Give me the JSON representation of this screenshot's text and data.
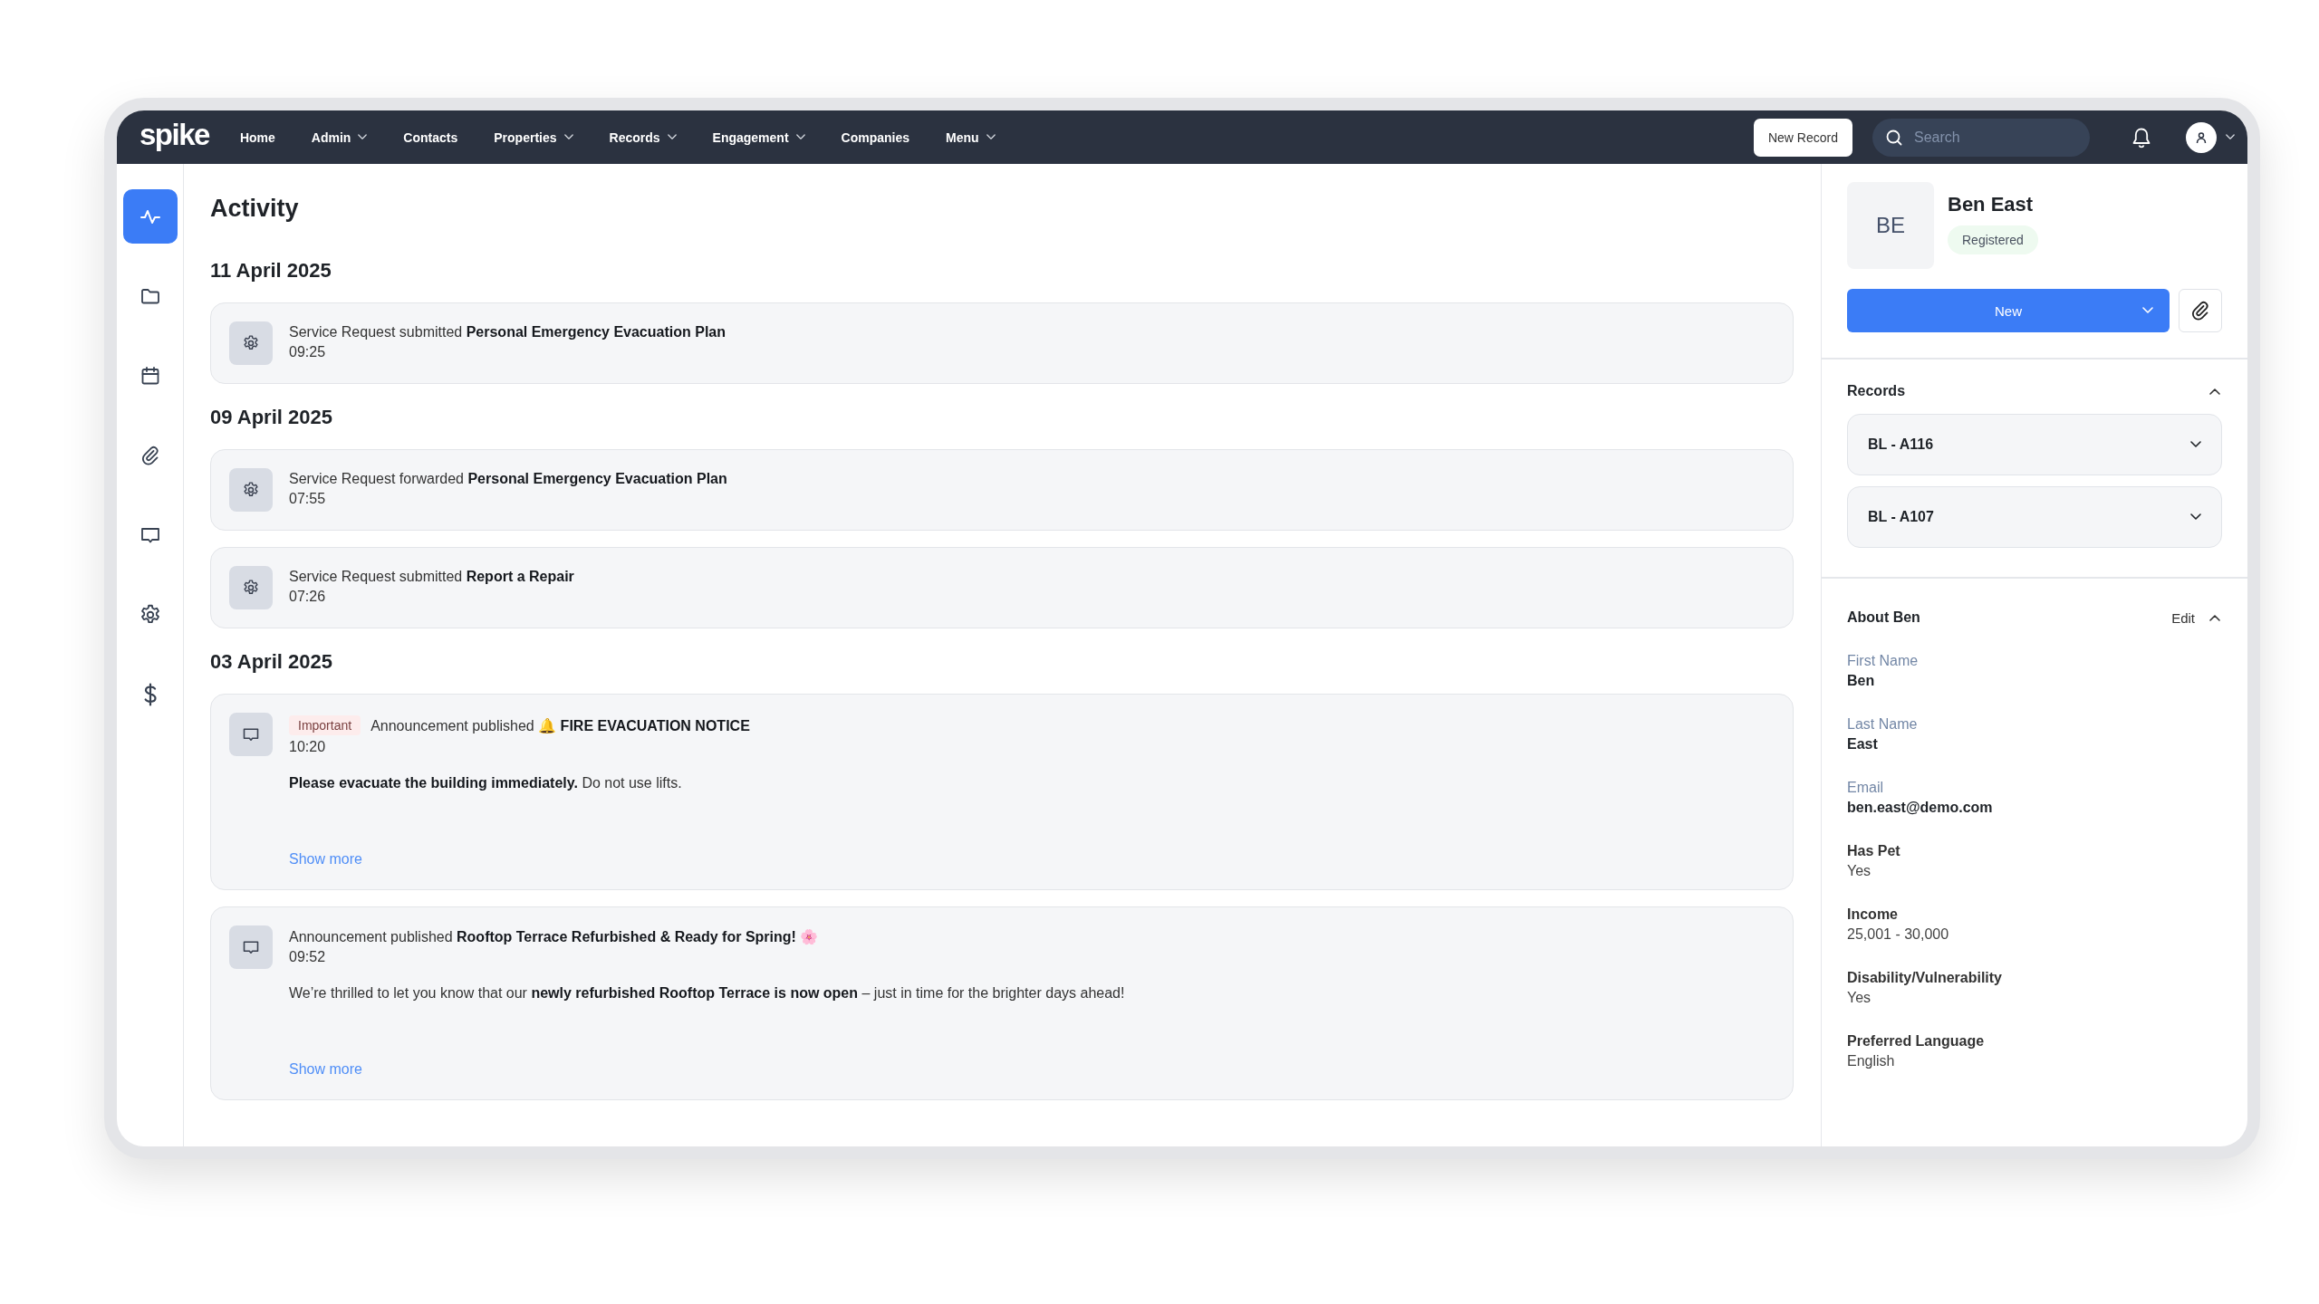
{
  "nav": {
    "logo": "spike",
    "items": [
      {
        "label": "Home",
        "dropdown": false
      },
      {
        "label": "Admin",
        "dropdown": true
      },
      {
        "label": "Contacts",
        "dropdown": false
      },
      {
        "label": "Properties",
        "dropdown": true
      },
      {
        "label": "Records",
        "dropdown": true
      },
      {
        "label": "Engagement",
        "dropdown": true
      },
      {
        "label": "Companies",
        "dropdown": false
      },
      {
        "label": "Menu",
        "dropdown": true
      }
    ],
    "new_record": "New Record",
    "search": {
      "placeholder": "Search"
    }
  },
  "sidebar": {
    "items": [
      {
        "kind": "activity",
        "selected": true
      },
      {
        "kind": "folder",
        "selected": false
      },
      {
        "kind": "calendar",
        "selected": false
      },
      {
        "kind": "attachment",
        "selected": false
      },
      {
        "kind": "message",
        "selected": false
      },
      {
        "kind": "settings",
        "selected": false
      },
      {
        "kind": "dollar",
        "selected": false
      }
    ]
  },
  "activity": {
    "title": "Activity",
    "groups": [
      {
        "date": "11 April 2025",
        "items": [
          {
            "kind": "service",
            "text": "Service Request submitted **Personal Emergency Evacuation Plan**",
            "time": "09:25"
          }
        ]
      },
      {
        "date": "09 April 2025",
        "items": [
          {
            "kind": "service",
            "text": "Service Request forwarded **Personal Emergency Evacuation Plan**",
            "time": "07:55"
          },
          {
            "kind": "service",
            "text": "Service Request submitted **Report a Repair**",
            "time": "07:26"
          }
        ]
      },
      {
        "date": "03 April 2025",
        "items": [
          {
            "kind": "announcement",
            "badge": "Important",
            "text": "Announcement published 🔔 **FIRE EVACUATION NOTICE**",
            "time": "10:20",
            "body": "**Please evacuate the building immediately.** Do not use lifts.",
            "link": "Show more"
          },
          {
            "kind": "announcement",
            "text": "Announcement published **Rooftop Terrace Refurbished & Ready for Spring!** 🌸",
            "time": "09:52",
            "body": "We’re thrilled to let you know that our **newly refurbished Rooftop Terrace is now open** – just in time for the brighter days ahead!",
            "link": "Show more"
          }
        ]
      }
    ]
  },
  "profile": {
    "initials": "BE",
    "name": "Ben East",
    "status": "Registered",
    "new_button": "New",
    "records": {
      "title": "Records",
      "expanded": true,
      "items": [
        {
          "label": "BL - A116",
          "expanded": false
        },
        {
          "label": "BL - A107",
          "expanded": false
        }
      ]
    },
    "about": {
      "title": "About Ben",
      "edit": "Edit",
      "expanded": true,
      "fields": [
        {
          "kind": "core",
          "label": "First Name",
          "value": "Ben"
        },
        {
          "kind": "core",
          "label": "Last Name",
          "value": "East"
        },
        {
          "kind": "core",
          "label": "Email",
          "value": "ben.east@demo.com"
        },
        {
          "kind": "custom",
          "label": "Has Pet",
          "value": "Yes"
        },
        {
          "kind": "custom",
          "label": "Income",
          "value": "25,001 - 30,000"
        },
        {
          "kind": "custom",
          "label": "Disability/Vulnerability",
          "value": "Yes"
        },
        {
          "kind": "custom",
          "label": "Preferred Language",
          "value": "English"
        }
      ]
    }
  }
}
